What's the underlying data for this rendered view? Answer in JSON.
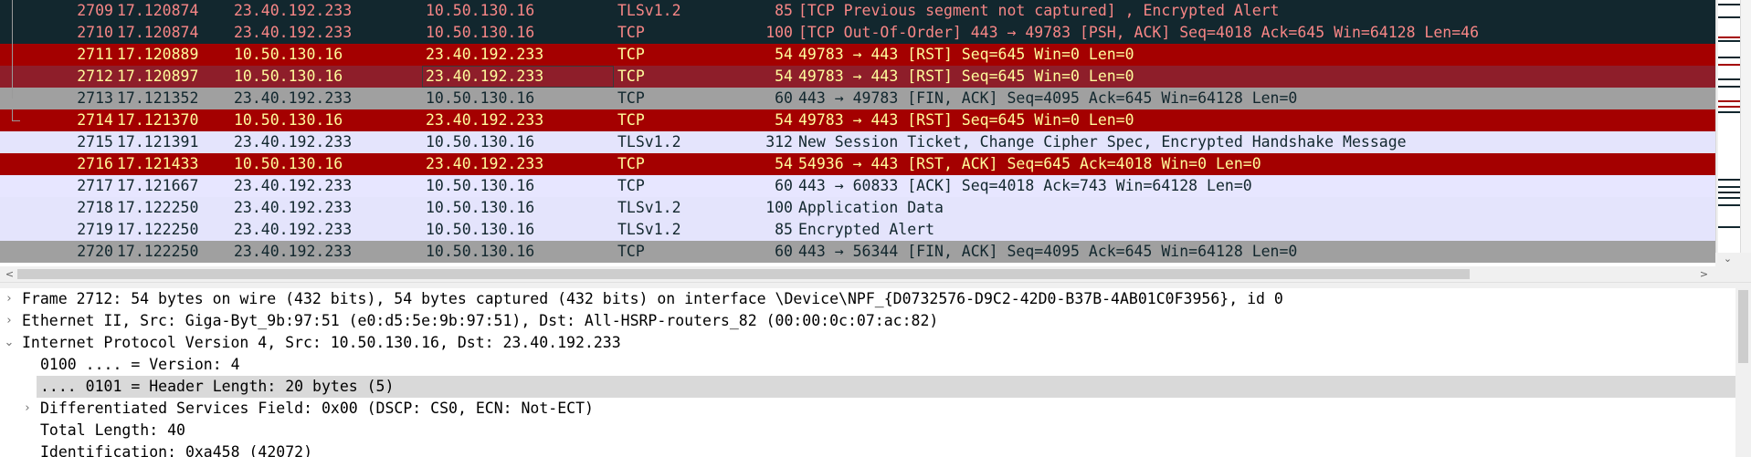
{
  "packet_list": {
    "rows": [
      {
        "no": "2709",
        "time": "17.120874",
        "src": "23.40.192.233",
        "dst": "10.50.130.16",
        "proto": "TLSv1.2",
        "len": "85",
        "info": "[TCP Previous segment not captured] , Encrypted Alert",
        "style": "s-dark"
      },
      {
        "no": "2710",
        "time": "17.120874",
        "src": "23.40.192.233",
        "dst": "10.50.130.16",
        "proto": "TCP",
        "len": "100",
        "info": "[TCP Out-Of-Order] 443 → 49783 [PSH, ACK] Seq=4018 Ack=645 Win=64128 Len=46",
        "style": "s-dark"
      },
      {
        "no": "2711",
        "time": "17.120889",
        "src": "10.50.130.16",
        "dst": "23.40.192.233",
        "proto": "TCP",
        "len": "54",
        "info": "49783 → 443 [RST] Seq=645 Win=0 Len=0",
        "style": "s-rst"
      },
      {
        "no": "2712",
        "time": "17.120897",
        "src": "10.50.130.16",
        "dst": "23.40.192.233",
        "proto": "TCP",
        "len": "54",
        "info": "49783 → 443 [RST] Seq=645 Win=0 Len=0",
        "style": "s-rstsel",
        "focused": true
      },
      {
        "no": "2713",
        "time": "17.121352",
        "src": "23.40.192.233",
        "dst": "10.50.130.16",
        "proto": "TCP",
        "len": "60",
        "info": "443 → 49783 [FIN, ACK] Seq=4095 Ack=645 Win=64128 Len=0",
        "style": "s-fin"
      },
      {
        "no": "2714",
        "time": "17.121370",
        "src": "10.50.130.16",
        "dst": "23.40.192.233",
        "proto": "TCP",
        "len": "54",
        "info": "49783 → 443 [RST] Seq=645 Win=0 Len=0",
        "style": "s-rst"
      },
      {
        "no": "2715",
        "time": "17.121391",
        "src": "23.40.192.233",
        "dst": "10.50.130.16",
        "proto": "TLSv1.2",
        "len": "312",
        "info": "New Session Ticket, Change Cipher Spec, Encrypted Handshake Message",
        "style": "s-tls"
      },
      {
        "no": "2716",
        "time": "17.121433",
        "src": "10.50.130.16",
        "dst": "23.40.192.233",
        "proto": "TCP",
        "len": "54",
        "info": "54936 → 443 [RST, ACK] Seq=645 Ack=4018 Win=0 Len=0",
        "style": "s-rst"
      },
      {
        "no": "2717",
        "time": "17.121667",
        "src": "23.40.192.233",
        "dst": "10.50.130.16",
        "proto": "TCP",
        "len": "60",
        "info": "443 → 60833 [ACK] Seq=4018 Ack=743 Win=64128 Len=0",
        "style": "s-tcp"
      },
      {
        "no": "2718",
        "time": "17.122250",
        "src": "23.40.192.233",
        "dst": "10.50.130.16",
        "proto": "TLSv1.2",
        "len": "100",
        "info": "Application Data",
        "style": "s-tls"
      },
      {
        "no": "2719",
        "time": "17.122250",
        "src": "23.40.192.233",
        "dst": "10.50.130.16",
        "proto": "TLSv1.2",
        "len": "85",
        "info": "Encrypted Alert",
        "style": "s-tls"
      },
      {
        "no": "2720",
        "time": "17.122250",
        "src": "23.40.192.233",
        "dst": "10.50.130.16",
        "proto": "TCP",
        "len": "60",
        "info": "443 → 56344 [FIN, ACK] Seq=4095 Ack=645 Win=64128 Len=0",
        "style": "s-fin"
      }
    ]
  },
  "scroll": {
    "left_arrow": "<",
    "right_arrow": ">",
    "down_arrow": "⌄"
  },
  "detail_tree": {
    "rows": [
      {
        "level": 0,
        "toggle": "›",
        "text": "Frame 2712: 54 bytes on wire (432 bits), 54 bytes captured (432 bits) on interface \\Device\\NPF_{D0732576-D9C2-42D0-B37B-4AB01C0F3956}, id 0",
        "selected": false
      },
      {
        "level": 0,
        "toggle": "›",
        "text": "Ethernet II, Src: Giga-Byt_9b:97:51 (e0:d5:5e:9b:97:51), Dst: All-HSRP-routers_82 (00:00:0c:07:ac:82)",
        "selected": false
      },
      {
        "level": 0,
        "toggle": "⌄",
        "text": "Internet Protocol Version 4, Src: 10.50.130.16, Dst: 23.40.192.233",
        "selected": false
      },
      {
        "level": 1,
        "toggle": "",
        "text": "0100 .... = Version: 4",
        "selected": false
      },
      {
        "level": 1,
        "toggle": "",
        "text": ".... 0101 = Header Length: 20 bytes (5)",
        "selected": true
      },
      {
        "level": 1,
        "toggle": "›",
        "text": "Differentiated Services Field: 0x00 (DSCP: CS0, ECN: Not-ECT)",
        "selected": false
      },
      {
        "level": 1,
        "toggle": "",
        "text": "Total Length: 40",
        "selected": false
      },
      {
        "level": 1,
        "toggle": "",
        "text": "Identification: 0xa458 (42072)",
        "selected": false
      }
    ]
  }
}
